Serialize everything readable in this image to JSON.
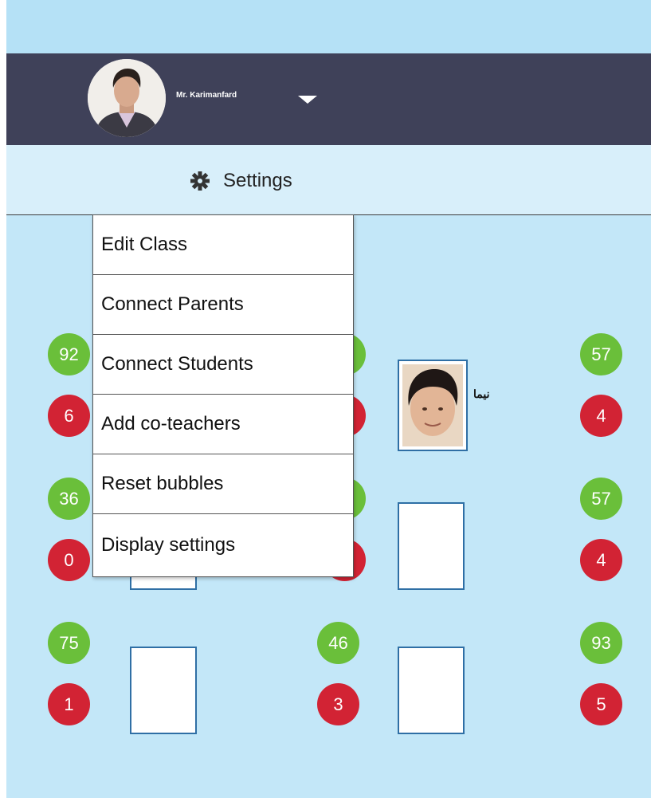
{
  "header": {
    "username": "Mr. Karimanfard"
  },
  "settings": {
    "label": "Settings"
  },
  "menu": {
    "items": [
      {
        "label": "Edit Class"
      },
      {
        "label": "Connect Parents"
      },
      {
        "label": "Connect Students"
      },
      {
        "label": "Add co-teachers"
      },
      {
        "label": "Reset bubbles"
      },
      {
        "label": "Display settings"
      }
    ]
  },
  "seats": [
    {
      "positive": "92",
      "negative": "6"
    },
    {
      "positive": "",
      "negative": ""
    },
    {
      "positive": "57",
      "negative": "4",
      "student_name": "نیما"
    },
    {
      "positive": "36",
      "negative": "0"
    },
    {
      "positive": "",
      "negative": ""
    },
    {
      "positive": "57",
      "negative": "4"
    },
    {
      "positive": "75",
      "negative": "1"
    },
    {
      "positive": "46",
      "negative": "3"
    },
    {
      "positive": "93",
      "negative": "5"
    }
  ],
  "colors": {
    "positive_bubble": "#6abf3a",
    "negative_bubble": "#d22334",
    "header_bg": "#3f4159",
    "desk_border": "#2f6fa5"
  }
}
